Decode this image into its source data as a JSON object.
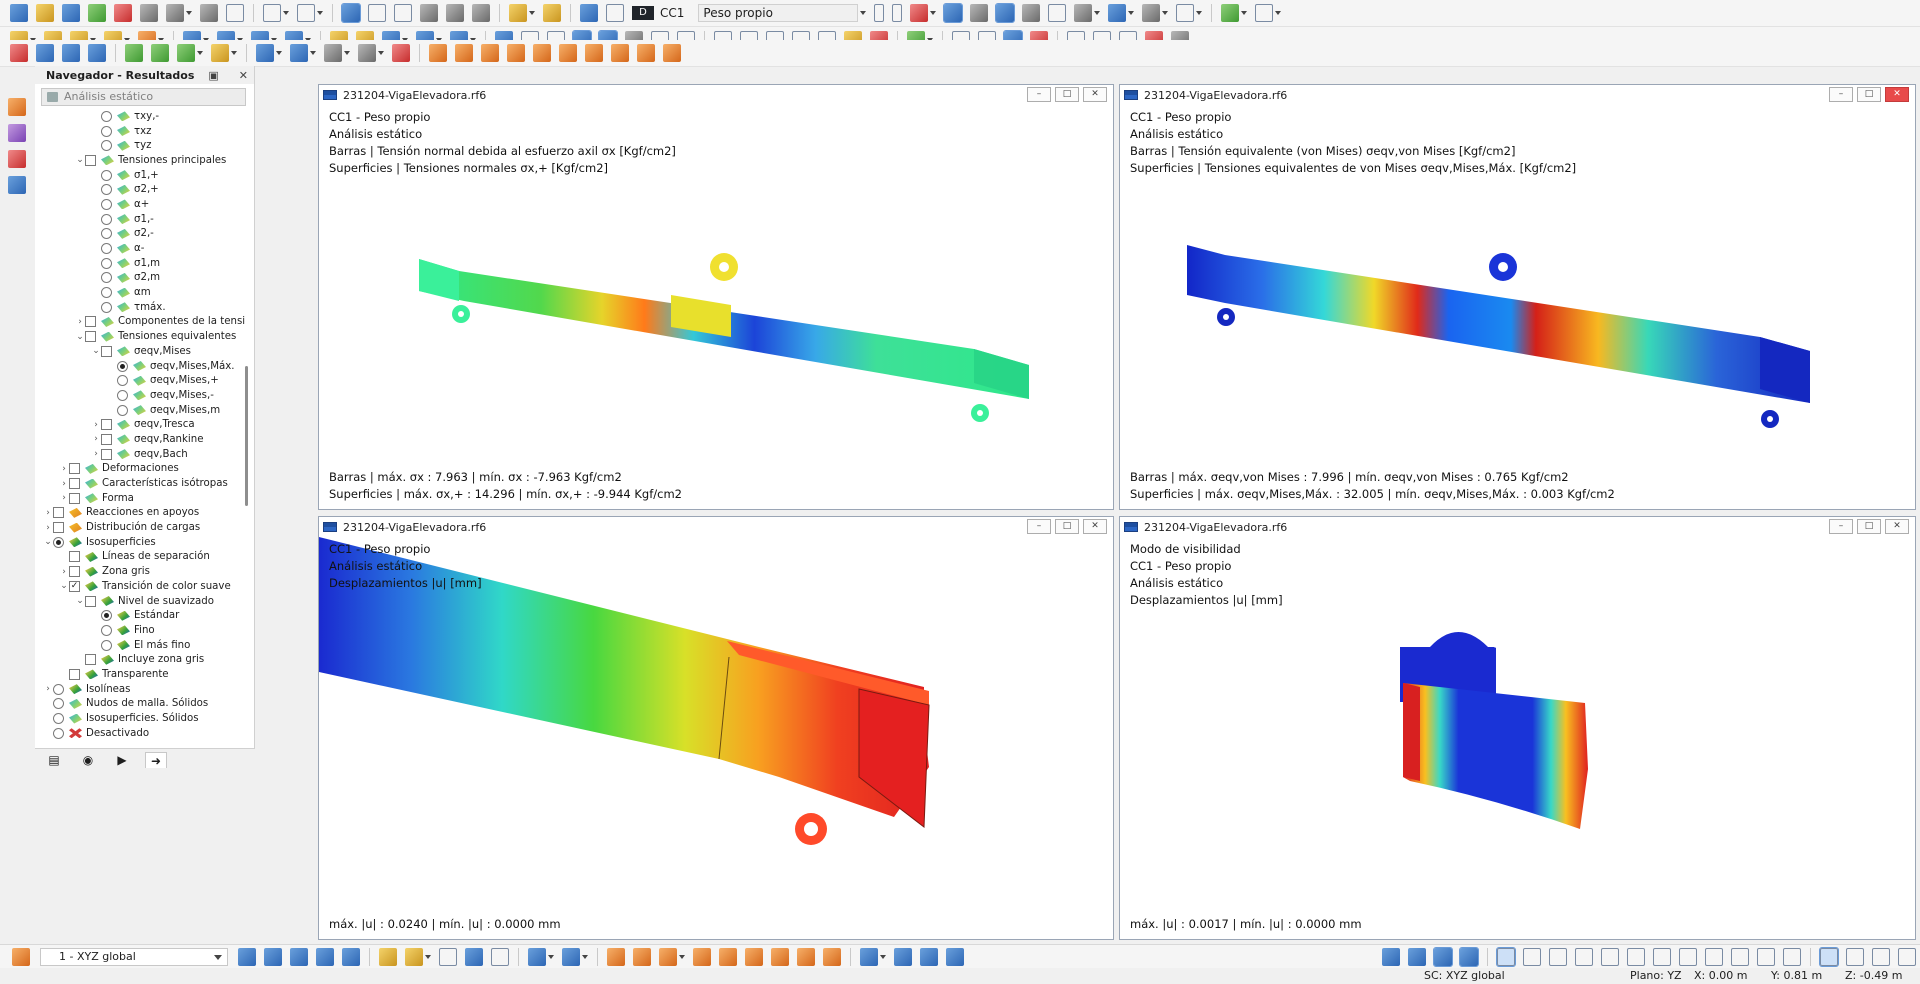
{
  "toolbar": {
    "load_case_color": "D",
    "load_case_id": "CC1",
    "load_case_name": "Peso propio"
  },
  "navigator": {
    "title": "Navegador - Resultados",
    "analysis_combo": "Análisis estático",
    "items": [
      {
        "label": "τxy,-",
        "type": "radio",
        "indent": 3,
        "checked": false,
        "icon": "stress"
      },
      {
        "label": "τxz",
        "type": "radio",
        "indent": 3,
        "checked": false,
        "icon": "stress"
      },
      {
        "label": "τyz",
        "type": "radio",
        "indent": 3,
        "checked": false,
        "icon": "stress"
      },
      {
        "label": "Tensiones principales",
        "type": "check",
        "indent": 2,
        "expanded": true,
        "checked": false,
        "icon": "stress"
      },
      {
        "label": "σ1,+",
        "type": "radio",
        "indent": 3,
        "checked": false,
        "icon": "stress"
      },
      {
        "label": "σ2,+",
        "type": "radio",
        "indent": 3,
        "checked": false,
        "icon": "stress"
      },
      {
        "label": "α+",
        "type": "radio",
        "indent": 3,
        "checked": false,
        "icon": "stress"
      },
      {
        "label": "σ1,-",
        "type": "radio",
        "indent": 3,
        "checked": false,
        "icon": "stress"
      },
      {
        "label": "σ2,-",
        "type": "radio",
        "indent": 3,
        "checked": false,
        "icon": "stress"
      },
      {
        "label": "α-",
        "type": "radio",
        "indent": 3,
        "checked": false,
        "icon": "stress"
      },
      {
        "label": "σ1,m",
        "type": "radio",
        "indent": 3,
        "checked": false,
        "icon": "stress"
      },
      {
        "label": "σ2,m",
        "type": "radio",
        "indent": 3,
        "checked": false,
        "icon": "stress"
      },
      {
        "label": "αm",
        "type": "radio",
        "indent": 3,
        "checked": false,
        "icon": "stress"
      },
      {
        "label": "τmáx.",
        "type": "radio",
        "indent": 3,
        "checked": false,
        "icon": "stress"
      },
      {
        "label": "Componentes de la tensió...",
        "type": "check",
        "indent": 2,
        "expanded": false,
        "checked": false,
        "icon": "stress"
      },
      {
        "label": "Tensiones equivalentes",
        "type": "check",
        "indent": 2,
        "expanded": true,
        "checked": false,
        "icon": "stress"
      },
      {
        "label": "σeqv,Mises",
        "type": "check",
        "indent": 3,
        "expanded": true,
        "checked": false,
        "icon": "stress"
      },
      {
        "label": "σeqv,Mises,Máx.",
        "type": "radio",
        "indent": 4,
        "checked": true,
        "icon": "stress"
      },
      {
        "label": "σeqv,Mises,+",
        "type": "radio",
        "indent": 4,
        "checked": false,
        "icon": "stress"
      },
      {
        "label": "σeqv,Mises,-",
        "type": "radio",
        "indent": 4,
        "checked": false,
        "icon": "stress"
      },
      {
        "label": "σeqv,Mises,m",
        "type": "radio",
        "indent": 4,
        "checked": false,
        "icon": "stress"
      },
      {
        "label": "σeqv,Tresca",
        "type": "check",
        "indent": 3,
        "expanded": false,
        "checked": false,
        "icon": "stress"
      },
      {
        "label": "σeqv,Rankine",
        "type": "check",
        "indent": 3,
        "expanded": false,
        "checked": false,
        "icon": "stress"
      },
      {
        "label": "σeqv,Bach",
        "type": "check",
        "indent": 3,
        "expanded": false,
        "checked": false,
        "icon": "stress"
      },
      {
        "label": "Deformaciones",
        "type": "check",
        "indent": 1,
        "expanded": false,
        "checked": false,
        "icon": "stress"
      },
      {
        "label": "Características isótropas",
        "type": "check",
        "indent": 1,
        "expanded": false,
        "checked": false,
        "icon": "stress"
      },
      {
        "label": "Forma",
        "type": "check",
        "indent": 1,
        "expanded": false,
        "checked": false,
        "icon": "stress"
      },
      {
        "label": "Reacciones en apoyos",
        "type": "check",
        "indent": 0,
        "expanded": false,
        "checked": false,
        "icon": "support"
      },
      {
        "label": "Distribución de cargas",
        "type": "check",
        "indent": 0,
        "expanded": false,
        "checked": false,
        "icon": "support"
      },
      {
        "label": "Isosuperficies",
        "type": "radio",
        "indent": 0,
        "expanded": true,
        "checked": true,
        "icon": "iso",
        "leading": true
      },
      {
        "label": "Líneas de separación",
        "type": "check",
        "indent": 1,
        "checked": false,
        "icon": "iso"
      },
      {
        "label": "Zona gris",
        "type": "check",
        "indent": 1,
        "expanded": false,
        "checked": false,
        "icon": "iso"
      },
      {
        "label": "Transición de color suave",
        "type": "check",
        "indent": 1,
        "expanded": true,
        "checked": true,
        "icon": "iso"
      },
      {
        "label": "Nivel de suavizado",
        "type": "check",
        "indent": 2,
        "expanded": true,
        "checked": false,
        "icon": "iso"
      },
      {
        "label": "Estándar",
        "type": "radio",
        "indent": 3,
        "checked": true,
        "icon": "iso"
      },
      {
        "label": "Fino",
        "type": "radio",
        "indent": 3,
        "checked": false,
        "icon": "iso"
      },
      {
        "label": "El más fino",
        "type": "radio",
        "indent": 3,
        "checked": false,
        "icon": "iso"
      },
      {
        "label": "Incluye zona gris",
        "type": "check",
        "indent": 2,
        "checked": false,
        "icon": "iso"
      },
      {
        "label": "Transparente",
        "type": "check",
        "indent": 1,
        "checked": false,
        "icon": "iso"
      },
      {
        "label": "Isolíneas",
        "type": "radio",
        "indent": 0,
        "expanded": false,
        "checked": false,
        "icon": "iso"
      },
      {
        "label": "Nudos de malla. Sólidos",
        "type": "radio",
        "indent": 0,
        "checked": false,
        "icon": "mesh"
      },
      {
        "label": "Isosuperficies. Sólidos",
        "type": "radio",
        "indent": 0,
        "checked": false,
        "icon": "mesh"
      },
      {
        "label": "Desactivado",
        "type": "radio",
        "indent": 0,
        "checked": false,
        "icon": "off"
      }
    ]
  },
  "windows": [
    {
      "title": "231204-VigaElevadora.rf6",
      "lines": [
        "CC1 - Peso propio",
        "Análisis estático",
        "Barras | Tensión normal debida al esfuerzo axil σx [Kgf/cm2]",
        "Superficies | Tensiones normales σx,+ [Kgf/cm2]"
      ],
      "footer": [
        "Barras | máx. σx : 7.963 | mín. σx : -7.963 Kgf/cm2",
        "Superficies | máx. σx,+ : 14.296 | mín. σx,+ : -9.944 Kgf/cm2"
      ]
    },
    {
      "title": "231204-VigaElevadora.rf6",
      "lines": [
        "CC1 - Peso propio",
        "Análisis estático",
        "Barras | Tensión equivalente (von Mises) σeqv,von Mises [Kgf/cm2]",
        "Superficies | Tensiones equivalentes de von Mises σeqv,Mises,Máx. [Kgf/cm2]"
      ],
      "footer": [
        "Barras | máx. σeqv,von Mises : 7.996 | mín. σeqv,von Mises : 0.765 Kgf/cm2",
        "Superficies | máx. σeqv,Mises,Máx. : 32.005 | mín. σeqv,Mises,Máx. : 0.003 Kgf/cm2"
      ]
    },
    {
      "title": "231204-VigaElevadora.rf6",
      "lines": [
        "CC1 - Peso propio",
        "Análisis estático",
        "Desplazamientos |u| [mm]"
      ],
      "footer": [
        "máx. |u| : 0.0240 | mín. |u| : 0.0000 mm"
      ]
    },
    {
      "title": "231204-VigaElevadora.rf6",
      "lines": [
        "Modo de visibilidad",
        "CC1 - Peso propio",
        "Análisis estático",
        "Desplazamientos |u| [mm]"
      ],
      "footer": [
        "máx. |u| : 0.0017 | mín. |u| : 0.0000 mm"
      ]
    }
  ],
  "bottom": {
    "view_select": "1 - XYZ global"
  },
  "status": {
    "sc": "SC: XYZ global",
    "plane": "Plano: YZ",
    "x": "X: 0.00 m",
    "y": "Y: 0.81 m",
    "z": "Z: -0.49 m"
  }
}
